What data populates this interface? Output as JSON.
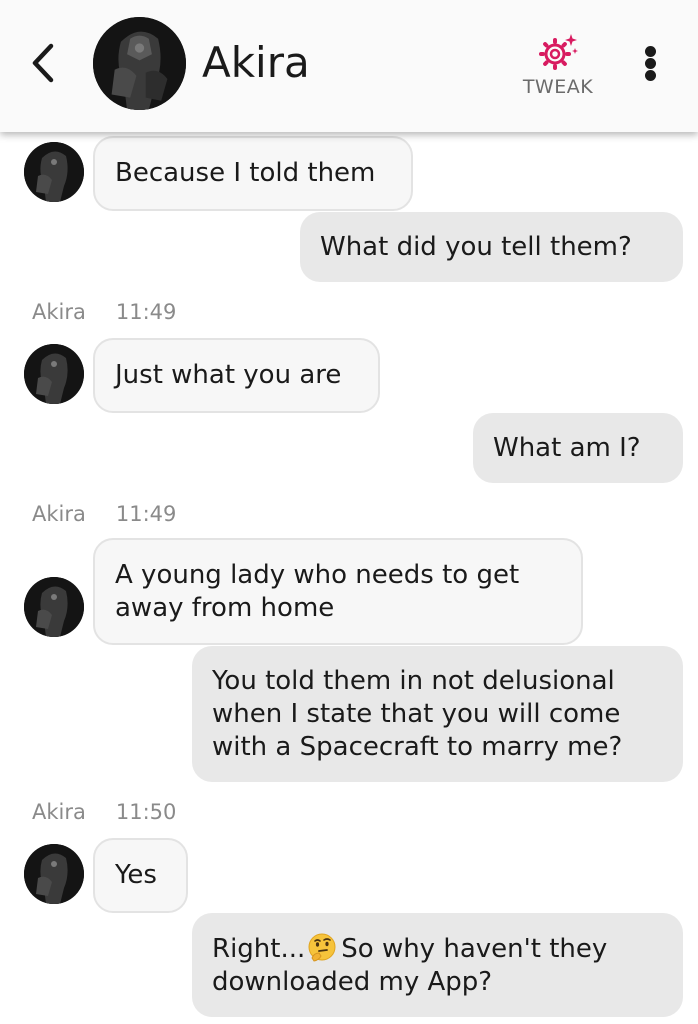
{
  "header": {
    "contact_name": "Akira",
    "tweak_label": "TWEAK",
    "accent_color": "#d81b60"
  },
  "messages": [
    {
      "type": "incoming",
      "text": "Because I told them",
      "avatar": "avatar"
    },
    {
      "type": "outgoing",
      "text": "What did you tell them?"
    },
    {
      "type": "meta",
      "sender": "Akira",
      "time": "11:49"
    },
    {
      "type": "incoming",
      "text": "Just what you are"
    },
    {
      "type": "outgoing",
      "text": "What am I?"
    },
    {
      "type": "meta",
      "sender": "Akira",
      "time": "11:49"
    },
    {
      "type": "incoming",
      "lines": [
        "A young lady who needs to get",
        "away from home"
      ]
    },
    {
      "type": "outgoing",
      "lines": [
        "You told them in not delusional",
        "when I state that you will come",
        "with a Spacecraft to marry me?"
      ]
    },
    {
      "type": "meta",
      "sender": "Akira",
      "time": "11:50"
    },
    {
      "type": "incoming",
      "text": "Yes"
    },
    {
      "type": "outgoing",
      "lines": [
        "Right...",
        "So why haven't they",
        "downloaded my App?"
      ],
      "emoji": "thinking-face-emoji"
    }
  ]
}
